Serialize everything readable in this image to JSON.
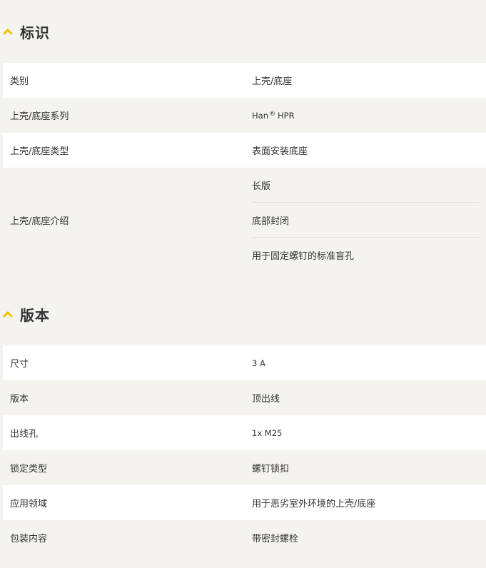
{
  "accent_color": "#f2c200",
  "sections": [
    {
      "title": "标识",
      "icon": "chevron-up-icon",
      "rows": [
        {
          "label": "类别",
          "value": "上壳/底座"
        },
        {
          "label": "上壳/底座系列",
          "value_prefix": "Han",
          "value_mark": "®",
          "value_suffix": "HPR"
        },
        {
          "label": "上壳/底座类型",
          "value": "表面安装底座"
        },
        {
          "label": "上壳/底座介绍",
          "values": [
            "长版",
            "底部封闭",
            "用于固定螺钉的标准盲孔"
          ]
        }
      ]
    },
    {
      "title": "版本",
      "icon": "chevron-up-icon",
      "rows": [
        {
          "label": "尺寸",
          "value": "3 A"
        },
        {
          "label": "版本",
          "value": "顶出线"
        },
        {
          "label": "出线孔",
          "value": "1x M25"
        },
        {
          "label": "锁定类型",
          "value": "螺钉锁扣"
        },
        {
          "label": "应用领域",
          "value": "用于恶劣室外环境的上壳/底座"
        },
        {
          "label": "包装内容",
          "value": "带密封螺栓"
        }
      ]
    }
  ]
}
